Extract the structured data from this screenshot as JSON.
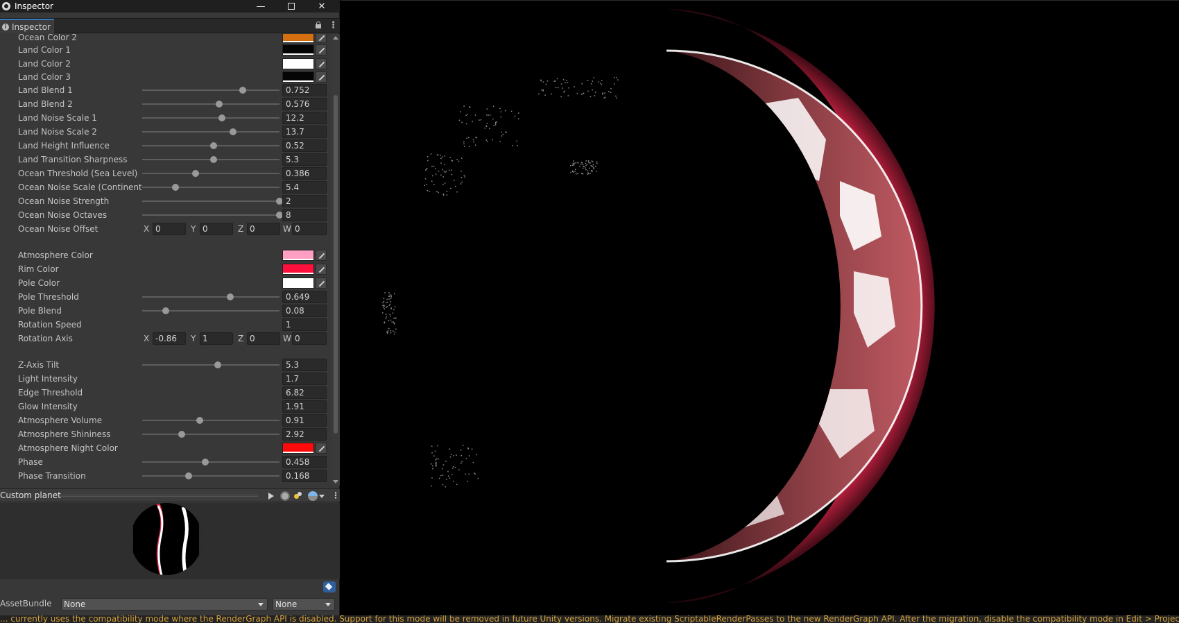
{
  "window": {
    "title": "Inspector",
    "controls": {
      "minimize": "—",
      "maximize": "",
      "close": "✕"
    }
  },
  "tab": {
    "label": "Inspector"
  },
  "properties": [
    {
      "label": "Ocean Color 2",
      "kind": "color",
      "color": "#d4700f",
      "y": 0
    },
    {
      "label": "Land Color 1",
      "kind": "color",
      "color": "#050505",
      "y": 19
    },
    {
      "label": "Land Color 2",
      "kind": "color",
      "color": "#ffffff",
      "y": 39
    },
    {
      "label": "Land Color 3",
      "kind": "color",
      "color": "#050505",
      "y": 59
    },
    {
      "label": "Land Blend 1",
      "kind": "slider",
      "value": "0.752",
      "fraction": 0.73
    },
    {
      "label": "Land Blend 2",
      "kind": "slider",
      "value": "0.576",
      "fraction": 0.56
    },
    {
      "label": "Land Noise Scale 1",
      "kind": "slider",
      "value": "12.2",
      "fraction": 0.58
    },
    {
      "label": "Land Noise Scale 2",
      "kind": "slider",
      "value": "13.7",
      "fraction": 0.66
    },
    {
      "label": "Land Height Influence",
      "kind": "slider",
      "value": "0.52",
      "fraction": 0.52
    },
    {
      "label": "Land Transition Sharpness",
      "kind": "slider",
      "value": "5.3",
      "fraction": 0.52
    },
    {
      "label": "Ocean Threshold (Sea Level)",
      "kind": "slider",
      "value": "0.386",
      "fraction": 0.39
    },
    {
      "label": "Ocean Noise Scale (Continent Size)",
      "kind": "slider",
      "value": "5.4",
      "fraction": 0.24
    },
    {
      "label": "Ocean Noise Strength",
      "kind": "slider",
      "value": "2",
      "fraction": 1.0
    },
    {
      "label": "Ocean Noise Octaves",
      "kind": "slider",
      "value": "8",
      "fraction": 1.0
    },
    {
      "label": "Ocean Noise Offset",
      "kind": "vector",
      "values": [
        "0",
        "0",
        "0",
        "0"
      ]
    },
    {
      "label": "Atmosphere Color",
      "kind": "color",
      "color": "#ff9fc3"
    },
    {
      "label": "Rim Color",
      "kind": "color",
      "color": "#ff0f3c"
    },
    {
      "label": "Pole Color",
      "kind": "color",
      "color": "#ffffff"
    },
    {
      "label": "Pole Threshold",
      "kind": "slider",
      "value": "0.649",
      "fraction": 0.64
    },
    {
      "label": "Pole Blend",
      "kind": "slider",
      "value": "0.08",
      "fraction": 0.17
    },
    {
      "label": "Rotation Speed",
      "kind": "number",
      "value": "1"
    },
    {
      "label": "Rotation Axis",
      "kind": "vector",
      "values": [
        "-0.86",
        "1",
        "0",
        "0"
      ]
    },
    {
      "label": "Z-Axis Tilt",
      "kind": "slider",
      "value": "5.3",
      "fraction": 0.55
    },
    {
      "label": "Light Intensity",
      "kind": "number",
      "value": "1.7"
    },
    {
      "label": "Edge Threshold",
      "kind": "number",
      "value": "6.82"
    },
    {
      "label": "Glow Intensity",
      "kind": "number",
      "value": "1.91"
    },
    {
      "label": "Atmosphere Volume",
      "kind": "slider",
      "value": "0.91",
      "fraction": 0.42
    },
    {
      "label": "Atmosphere Shininess",
      "kind": "slider",
      "value": "2.92",
      "fraction": 0.29
    },
    {
      "label": "Atmosphere Night Color",
      "kind": "color",
      "color": "#ff0a0a"
    },
    {
      "label": "Phase",
      "kind": "slider",
      "value": "0.458",
      "fraction": 0.46
    },
    {
      "label": "Phase Transition",
      "kind": "slider",
      "value": "0.168",
      "fraction": 0.34
    }
  ],
  "vector_axes": [
    "X",
    "Y",
    "Z",
    "W"
  ],
  "preview": {
    "title": "Custom planet"
  },
  "asset_bundle": {
    "label": "AssetBundle",
    "name": "None",
    "variant": "None"
  },
  "status_message": "... currently uses the compatibility mode where the RenderGraph API is disabled. Support for this mode will be removed in future Unity versions. Migrate existing ScriptableRenderPasses to the new RenderGraph API. After the migration, disable the compatibility mode in Edit > Projects Settings > Graphics > Render Graph.",
  "colors": {
    "atmosphere_glow": "#ff2b55",
    "planet_lit": "#b5555c",
    "land_white": "#ffffff"
  }
}
